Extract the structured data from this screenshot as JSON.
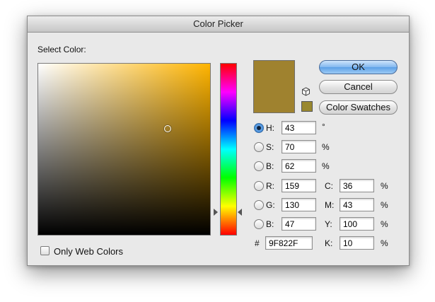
{
  "window": {
    "title": "Color Picker"
  },
  "select_label": "Select Color:",
  "buttons": {
    "ok": "OK",
    "cancel": "Cancel",
    "swatches": "Color Swatches"
  },
  "current_color_hex_value": "#9f822f",
  "fields": {
    "h": {
      "label": "H:",
      "value": "43",
      "unit": "°",
      "selected": true
    },
    "s": {
      "label": "S:",
      "value": "70",
      "unit": "%"
    },
    "b": {
      "label": "B:",
      "value": "62",
      "unit": "%"
    },
    "r": {
      "label": "R:",
      "value": "159"
    },
    "g": {
      "label": "G:",
      "value": "130"
    },
    "b2": {
      "label": "B:",
      "value": "47"
    },
    "c": {
      "label": "C:",
      "value": "36",
      "unit": "%"
    },
    "m": {
      "label": "M:",
      "value": "43",
      "unit": "%"
    },
    "y": {
      "label": "Y:",
      "value": "100",
      "unit": "%"
    },
    "k": {
      "label": "K:",
      "value": "10",
      "unit": "%"
    },
    "hex": {
      "label": "#",
      "value": "9F822F"
    }
  },
  "only_web_colors": {
    "label": "Only Web Colors",
    "checked": false
  },
  "colors": {
    "hue_base": "#ffb400",
    "swatch": "#9f822f",
    "accent": "#5da0e6"
  },
  "icons": {
    "gamut_warning": "cube-icon"
  }
}
